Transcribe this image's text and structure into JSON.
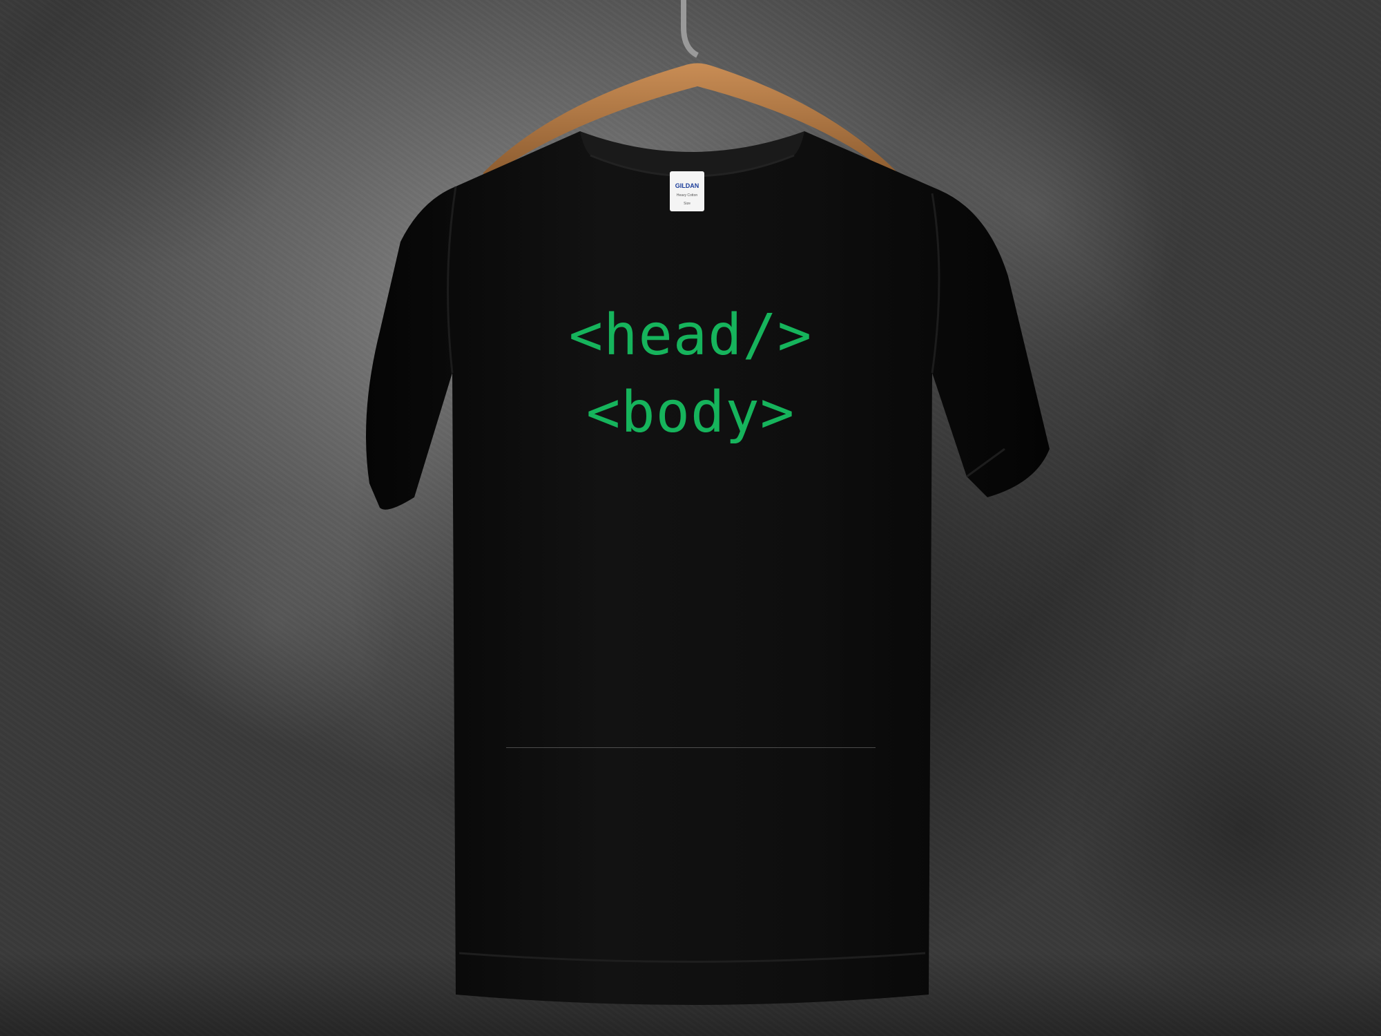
{
  "scene": {
    "description_type": "product-mockup",
    "wall_color": "#6e6e6e",
    "shirt_color": "#0b0b0b",
    "hanger_color": "#b07a45",
    "print_color": "#16b45c"
  },
  "shirt_print": {
    "line1": "<head/>",
    "line2": "<body>"
  },
  "neck_tag": {
    "brand": "GILDAN",
    "line2": "Heavy Cotton",
    "line3": "Size"
  }
}
